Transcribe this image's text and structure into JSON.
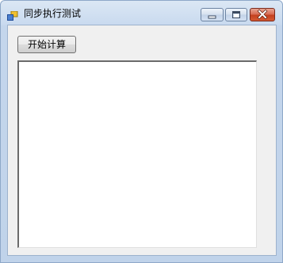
{
  "window": {
    "title": "同步执行测试",
    "icon": "app-window-icon"
  },
  "caption_buttons": {
    "minimize_icon": "minimize-icon",
    "maximize_icon": "maximize-icon",
    "close_icon": "close-icon"
  },
  "main": {
    "start_button_label": "开始计算",
    "output_text": ""
  },
  "colors": {
    "close_button": "#c4411f",
    "client_background": "#f0f0f0",
    "titlebar": "#c9daef"
  }
}
